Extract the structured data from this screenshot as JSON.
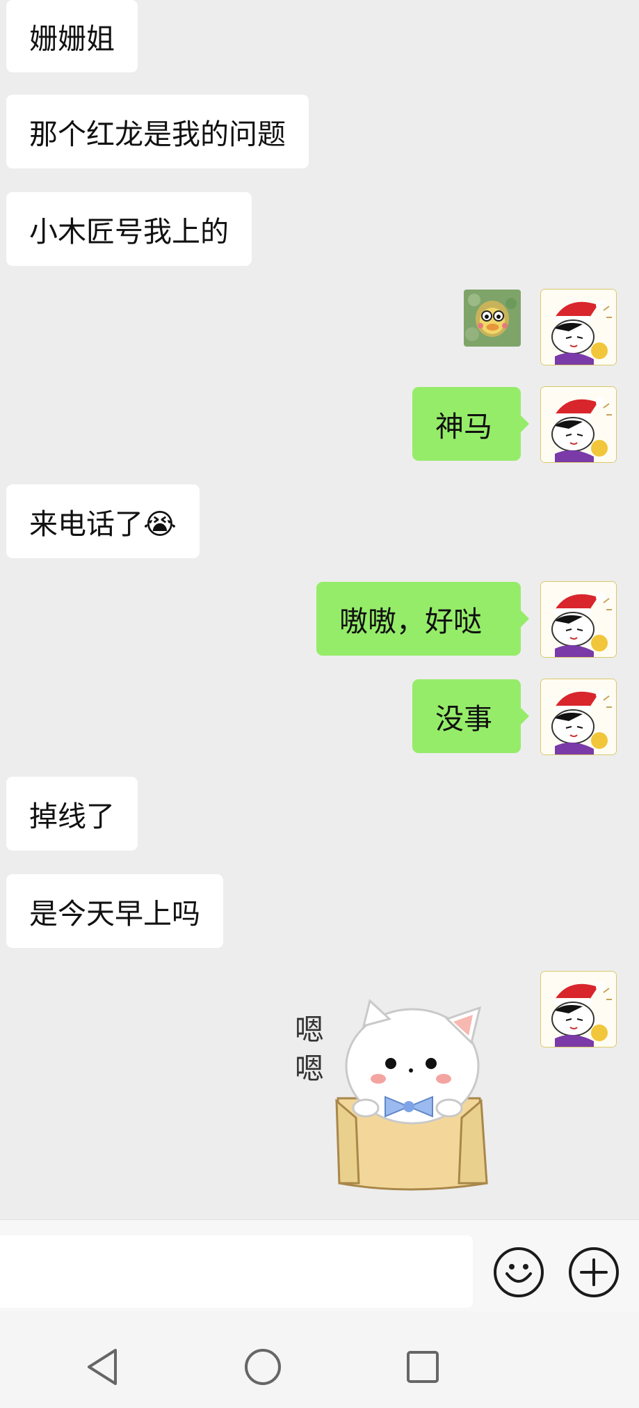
{
  "messages": [
    {
      "side": "left",
      "text": "姗姗姐"
    },
    {
      "side": "left",
      "text": "那个红龙是我的问题"
    },
    {
      "side": "left",
      "text": "小木匠号我上的"
    },
    {
      "side": "right",
      "type": "image",
      "content": "duck-emoji"
    },
    {
      "side": "right",
      "text": "神马"
    },
    {
      "side": "left",
      "text": "来电话了😭"
    },
    {
      "side": "right",
      "text": "嗷嗷，好哒"
    },
    {
      "side": "right",
      "text": "没事"
    },
    {
      "side": "left",
      "text": "掉线了"
    },
    {
      "side": "left",
      "text": "是今天早上吗"
    },
    {
      "side": "right",
      "type": "sticker",
      "content": "cat-in-box",
      "caption": "嗯嗯"
    }
  ],
  "input": {
    "value": "",
    "placeholder": ""
  },
  "icons": {
    "emoji": "smiley-face-icon",
    "plus": "plus-circle-icon",
    "nav_back": "triangle-back-icon",
    "nav_home": "circle-home-icon",
    "nav_recent": "square-recents-icon"
  },
  "colors": {
    "background": "#ededed",
    "bubble_received": "#ffffff",
    "bubble_sent": "#95ec69",
    "text": "#111111"
  }
}
